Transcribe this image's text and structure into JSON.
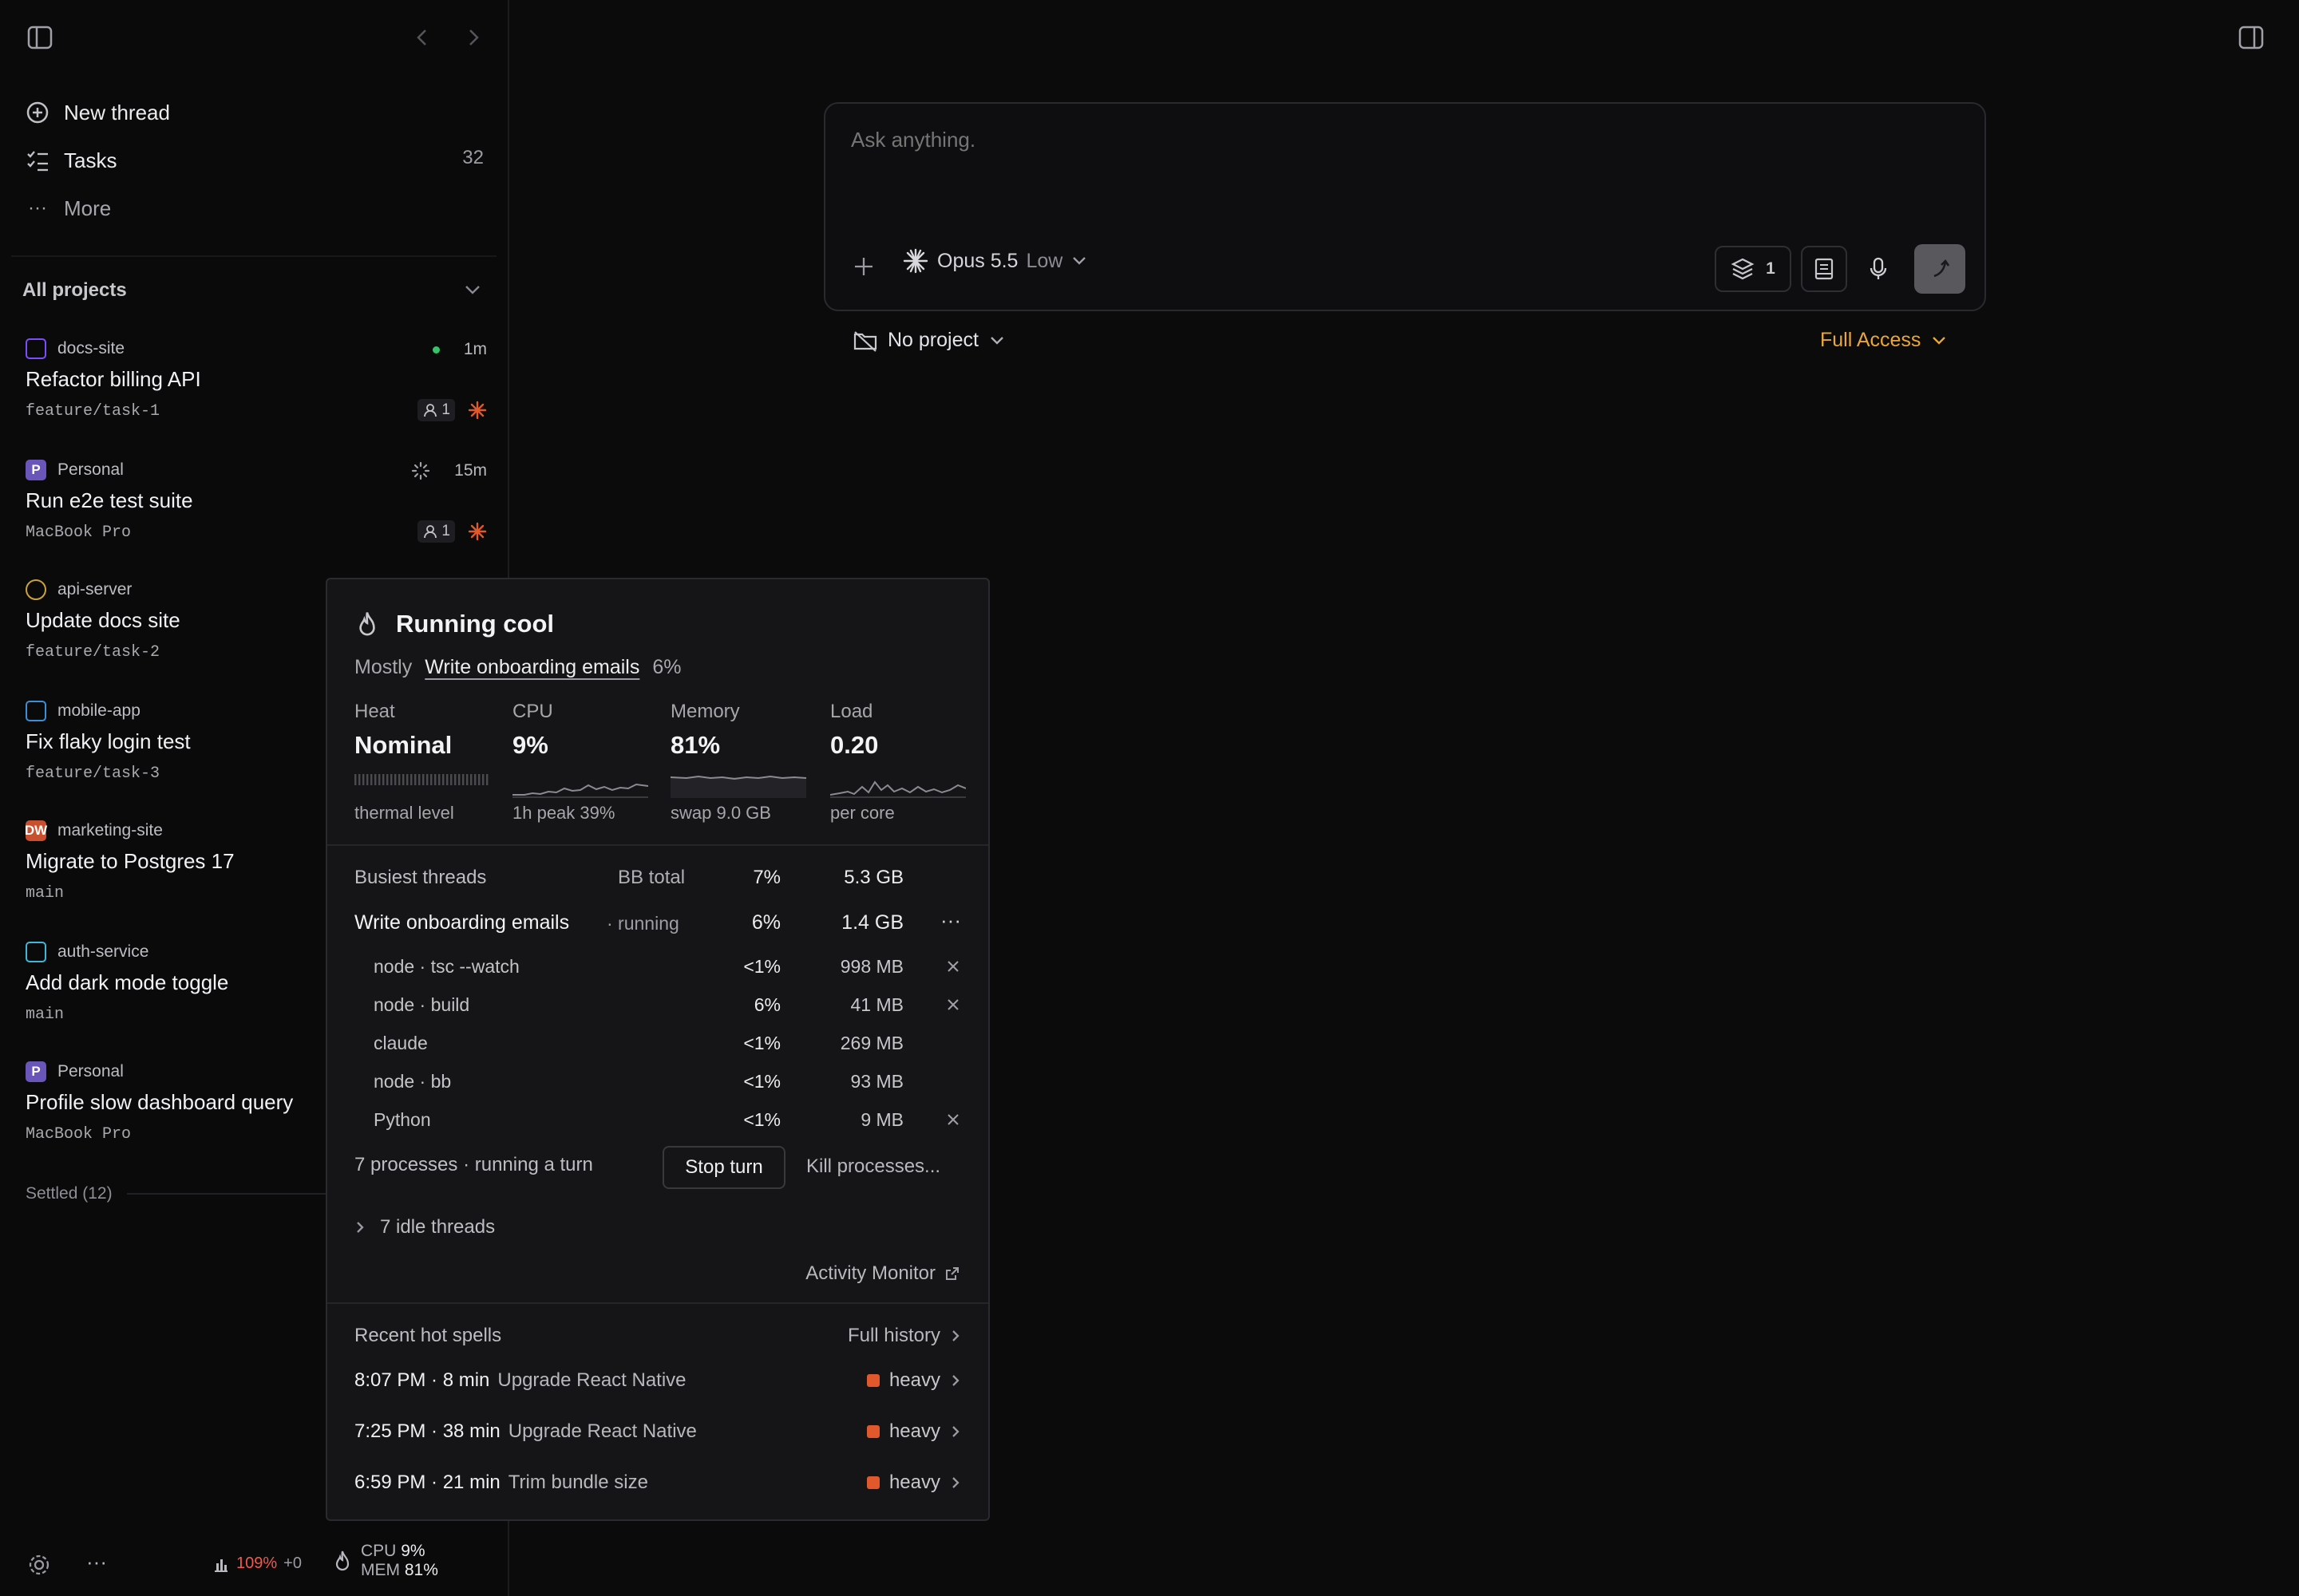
{
  "nav": {
    "new_thread": "New thread",
    "tasks": "Tasks",
    "tasks_count": "32",
    "more": "More"
  },
  "projects": {
    "title": "All projects",
    "threads": [
      {
        "project": "docs-site",
        "icon_letter": "",
        "icon_color": "#7c4dff",
        "title": "Refactor billing API",
        "sub": "feature/task-1",
        "time": "1m",
        "badge": "1"
      },
      {
        "project": "Personal",
        "icon_letter": "P",
        "icon_color": "#6a55b8",
        "title": "Run e2e test suite",
        "sub": "MacBook Pro",
        "time": "15m",
        "badge": "1"
      },
      {
        "project": "api-server",
        "icon_letter": "",
        "icon_color": "#caa23a",
        "title": "Update docs site",
        "sub": "feature/task-2",
        "time": "",
        "badge": ""
      },
      {
        "project": "mobile-app",
        "icon_letter": "",
        "icon_color": "#3a8fd6",
        "title": "Fix flaky login test",
        "sub": "feature/task-3",
        "time": "",
        "badge": ""
      },
      {
        "project": "marketing-site",
        "icon_letter": "DW",
        "icon_color": "#c8502e",
        "title": "Migrate to Postgres 17",
        "sub": "main",
        "time": "",
        "badge": ""
      },
      {
        "project": "auth-service",
        "icon_letter": "",
        "icon_color": "#3fb7d9",
        "title": "Add dark mode toggle",
        "sub": "main",
        "time": "",
        "badge": ""
      },
      {
        "project": "Personal",
        "icon_letter": "P",
        "icon_color": "#6a55b8",
        "title": "Profile slow dashboard query",
        "sub": "MacBook Pro",
        "time": "",
        "badge": ""
      }
    ],
    "settled": "Settled (12)"
  },
  "bottombar": {
    "load_pct": "109%",
    "load_delta": "+0",
    "cpu_label": "CPU",
    "cpu_val": "9%",
    "mem_label": "MEM",
    "mem_val": "81%"
  },
  "composer": {
    "placeholder": "Ask anything.",
    "model": "Opus 5.5",
    "effort": "Low",
    "layers_count": "1",
    "project": "No project",
    "access": "Full Access"
  },
  "popover": {
    "title": "Running cool",
    "mostly_label": "Mostly",
    "mostly_thread": "Write onboarding emails",
    "mostly_pct": "6%",
    "metrics": [
      {
        "label": "Heat",
        "value": "Nominal",
        "sub": "thermal level"
      },
      {
        "label": "CPU",
        "value": "9%",
        "sub": "1h peak 39%"
      },
      {
        "label": "Memory",
        "value": "81%",
        "sub": "swap 9.0 GB"
      },
      {
        "label": "Load",
        "value": "0.20",
        "sub": "per core"
      }
    ],
    "busiest": {
      "title": "Busiest threads",
      "total_label": "BB total",
      "total_cpu": "7%",
      "total_mem": "5.3 GB",
      "thread_name": "Write onboarding emails",
      "thread_state": "· running",
      "thread_cpu": "6%",
      "thread_mem": "1.4 GB",
      "procs": [
        {
          "name": "node · tsc --watch",
          "cpu": "<1%",
          "mem": "998 MB",
          "kill": true
        },
        {
          "name": "node · build",
          "cpu": "6%",
          "mem": "41 MB",
          "kill": true
        },
        {
          "name": "claude",
          "cpu": "<1%",
          "mem": "269 MB",
          "kill": false
        },
        {
          "name": "node · bb",
          "cpu": "<1%",
          "mem": "93 MB",
          "kill": false
        },
        {
          "name": "Python",
          "cpu": "<1%",
          "mem": "9 MB",
          "kill": true
        }
      ],
      "summary": "7 processes · running a turn",
      "stop_turn": "Stop turn",
      "kill_processes": "Kill processes..."
    },
    "idle": "7 idle threads",
    "activity_monitor": "Activity Monitor",
    "recent": {
      "title": "Recent hot spells",
      "full_history": "Full history",
      "spells": [
        {
          "time": "8:07 PM · 8 min",
          "name": "Upgrade React Native",
          "level": "heavy"
        },
        {
          "time": "7:25 PM · 38 min",
          "name": "Upgrade React Native",
          "level": "heavy"
        },
        {
          "time": "6:59 PM · 21 min",
          "name": "Trim bundle size",
          "level": "heavy"
        }
      ]
    }
  }
}
